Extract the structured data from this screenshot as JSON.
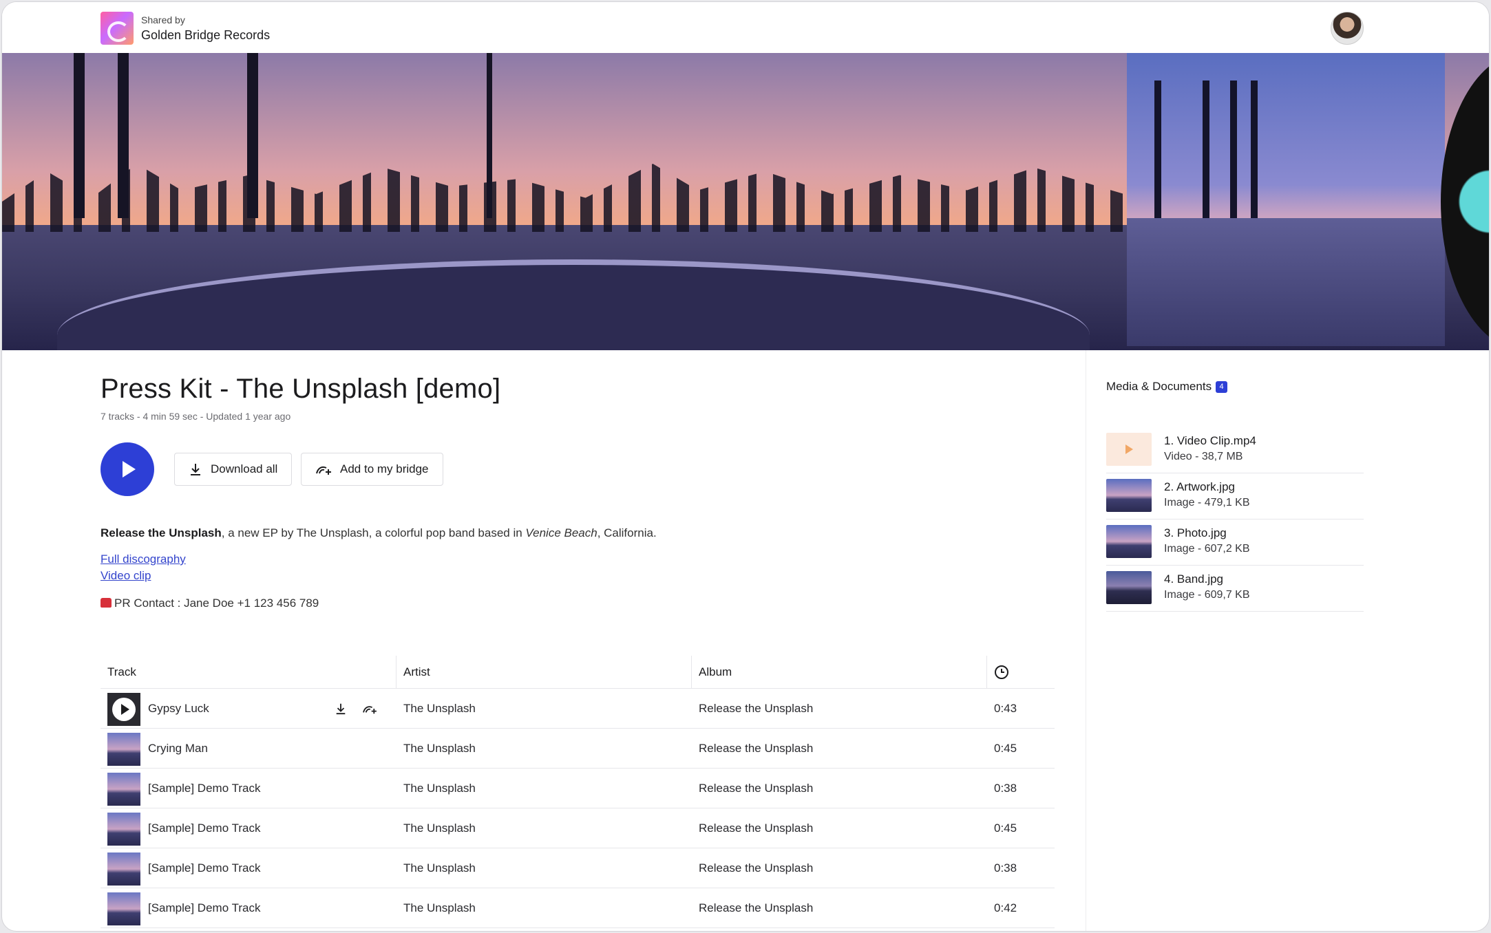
{
  "header": {
    "shared_by_label": "Shared by",
    "company_name": "Golden Bridge Records"
  },
  "main": {
    "title": "Press Kit - The Unsplash [demo]",
    "meta": "7 tracks - 4 min 59 sec - Updated 1 year ago",
    "download_all_label": "Download all",
    "add_to_bridge_label": "Add to my bridge",
    "description": {
      "bold": "Release the Unsplash",
      "part1": ", a new EP by The Unsplash, a colorful pop band based in ",
      "italic": "Venice Beach",
      "part2": ", California."
    },
    "links": [
      "Full discography",
      "Video clip"
    ],
    "pr_contact": "PR Contact : Jane Doe +1 123 456 789"
  },
  "tracks": {
    "columns": [
      "Track",
      "Artist",
      "Album"
    ],
    "rows": [
      {
        "title": "Gypsy Luck",
        "artist": "The Unsplash",
        "album": "Release the Unsplash",
        "duration": "0:43"
      },
      {
        "title": "Crying Man",
        "artist": "The Unsplash",
        "album": "Release the Unsplash",
        "duration": "0:45"
      },
      {
        "title": "[Sample] Demo Track",
        "artist": "The Unsplash",
        "album": "Release the Unsplash",
        "duration": "0:38"
      },
      {
        "title": "[Sample] Demo Track",
        "artist": "The Unsplash",
        "album": "Release the Unsplash",
        "duration": "0:45"
      },
      {
        "title": "[Sample] Demo Track",
        "artist": "The Unsplash",
        "album": "Release the Unsplash",
        "duration": "0:38"
      },
      {
        "title": "[Sample] Demo Track",
        "artist": "The Unsplash",
        "album": "Release the Unsplash",
        "duration": "0:42"
      }
    ]
  },
  "sidebar": {
    "title": "Media & Documents",
    "count": "4",
    "items": [
      {
        "name": "1. Video Clip.mp4",
        "info": "Video - 38,7 MB",
        "kind": "video"
      },
      {
        "name": "2. Artwork.jpg",
        "info": "Image - 479,1 KB",
        "kind": "image"
      },
      {
        "name": "3. Photo.jpg",
        "info": "Image - 607,2 KB",
        "kind": "image"
      },
      {
        "name": "4. Band.jpg",
        "info": "Image - 609,7 KB",
        "kind": "image"
      }
    ]
  },
  "colors": {
    "accent": "#2d3fd6",
    "link": "#3344cc",
    "video_play": "#f1a766"
  }
}
